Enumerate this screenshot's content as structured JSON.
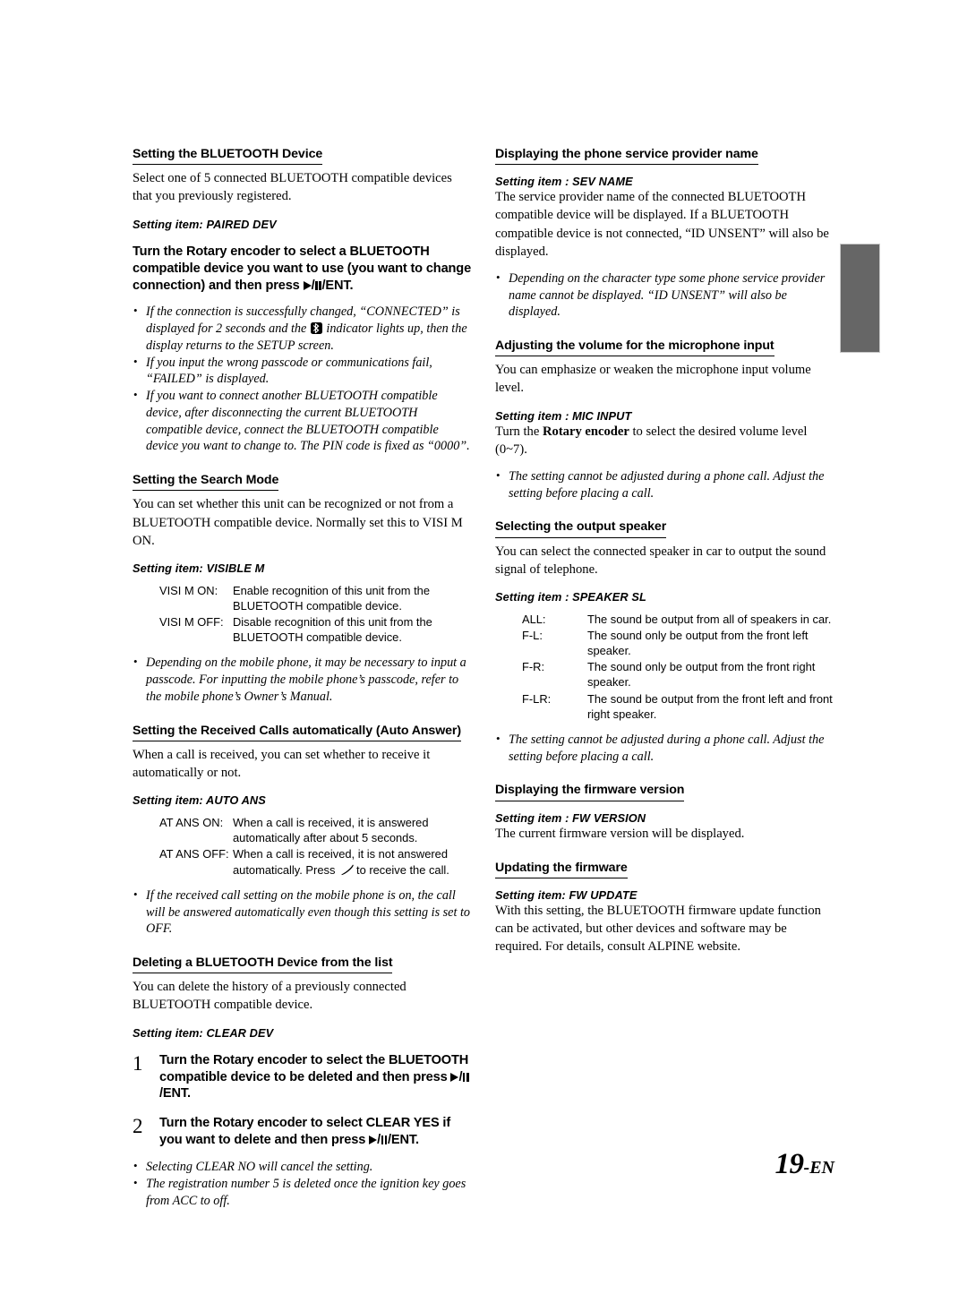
{
  "document": {
    "page_number": "19",
    "page_suffix": "-EN",
    "thumb_tab": {
      "color": "#666666"
    }
  },
  "left_column": {
    "sections": [
      {
        "heading": "Setting the BLUETOOTH Device",
        "body": [
          "Select one of 5 connected BLUETOOTH compatible devices that you previously registered."
        ],
        "setting_item": "Setting item: PAIRED DEV",
        "instruction_prefix": "Turn the ",
        "instruction_bold": "Rotary encoder",
        "instruction_mid": " to select a BLUETOOTH compatible device you want to use (you want to change connection) and then press ",
        "instruction_suffix": "/ENT.",
        "notes": [
          "If the connection is successfully changed, “CONNECTED” is displayed for 2 seconds and the",
          "indicator lights up, then the display returns to the SETUP screen.",
          "If you input the wrong passcode or communications fail, “FAILED” is displayed.",
          "If you want to connect another BLUETOOTH compatible device, after disconnecting the current BLUETOOTH compatible device, connect the BLUETOOTH compatible device you want to change to. The PIN code is fixed as “0000”."
        ]
      },
      {
        "heading": "Setting the Search Mode",
        "body": [
          "You can set whether this unit can be recognized or not from a BLUETOOTH compatible device. Normally set this to VISI M ON."
        ],
        "setting_item": "Setting item: VISIBLE M",
        "definitions": [
          {
            "term": "VISI M ON:",
            "desc": "Enable recognition of this unit from the BLUETOOTH compatible device."
          },
          {
            "term": "VISI M OFF:",
            "desc": "Disable recognition of this unit from the BLUETOOTH compatible device."
          }
        ],
        "notes": [
          "Depending on the mobile phone, it may be necessary to input a passcode. For inputting the mobile phone’s passcode, refer to the mobile phone’s Owner’s Manual."
        ]
      },
      {
        "heading": "Setting the Received Calls automatically (Auto Answer)",
        "body": [
          "When a call is received, you can set whether to receive it automatically or not."
        ],
        "setting_item": "Setting item: AUTO ANS",
        "definitions": [
          {
            "term": "AT ANS ON:",
            "desc": "When a call is received, it is answered automatically after about 5 seconds."
          },
          {
            "term": "AT ANS OFF:",
            "desc_before": "When a call is received, it is not answered automatically. Press",
            "desc_after": "to receive the call."
          }
        ],
        "notes": [
          "If the received call setting on the mobile phone is on, the call will be answered automatically even though this setting is set to OFF."
        ]
      },
      {
        "heading": "Deleting a BLUETOOTH Device from the list",
        "body": [
          "You can delete the history of a previously connected BLUETOOTH compatible device."
        ],
        "setting_item": "Setting item: CLEAR DEV",
        "steps": [
          {
            "number": "1",
            "prefix": "Turn the ",
            "bold": "Rotary encoder",
            "mid": " to select the BLUETOOTH compatible device to be deleted and then press ",
            "suffix": "/ENT."
          },
          {
            "number": "2",
            "prefix": "Turn the ",
            "bold": "Rotary encoder",
            "mid": " to select CLEAR YES if you want to delete and then press ",
            "suffix": "/ENT."
          }
        ],
        "notes": [
          "Selecting CLEAR NO will cancel the setting.",
          "The registration number 5 is deleted once the ignition key goes from ACC to off."
        ]
      }
    ]
  },
  "right_column": {
    "sections": [
      {
        "heading": "Displaying the phone service provider name",
        "setting_item": "Setting item : SEV NAME",
        "body": [
          "The service provider name of the connected BLUETOOTH compatible device will be displayed. If a BLUETOOTH compatible device is not connected, “ID UNSENT” will also be displayed."
        ],
        "notes": [
          "Depending on the character type some phone service provider name cannot be displayed. “ID UNSENT” will also be displayed."
        ]
      },
      {
        "heading": "Adjusting the volume for the microphone input",
        "body": [
          "You can emphasize or weaken the microphone input volume level."
        ],
        "setting_item": "Setting item : MIC INPUT",
        "body_after_prefix": "Turn the ",
        "body_after_bold": "Rotary encoder",
        "body_after_suffix": " to select the desired volume level (0~7).",
        "notes": [
          "The setting cannot be adjusted during a phone call. Adjust the setting before placing a call."
        ]
      },
      {
        "heading": "Selecting the output speaker",
        "body": [
          "You can select the connected speaker in car to output the sound signal of telephone."
        ],
        "setting_item": "Setting item : SPEAKER SL",
        "definitions": [
          {
            "term": "ALL:",
            "desc": "The sound  be output from all of speakers in car."
          },
          {
            "term": "F-L:",
            "desc": "The sound only be output from the front left speaker."
          },
          {
            "term": "F-R:",
            "desc": "The sound only be output from the front right speaker."
          },
          {
            "term": "F-LR:",
            "desc": "The sound  be output from the front left and front right speaker."
          }
        ],
        "notes": [
          "The setting cannot be adjusted during a phone call. Adjust the setting before placing a call."
        ]
      },
      {
        "heading": "Displaying the firmware version",
        "setting_item": "Setting item : FW VERSION",
        "body": [
          "The current firmware version will be displayed."
        ]
      },
      {
        "heading": "Updating the firmware",
        "setting_item": "Setting item: FW UPDATE",
        "body": [
          "With this setting, the BLUETOOTH firmware update function can be activated, but other devices and software may be required. For details, consult ALPINE website."
        ]
      }
    ]
  },
  "icons": {
    "play_pause": "play-pause-ent-icon",
    "bluetooth": "bluetooth-indicator-icon",
    "phone": "phone-receive-icon"
  }
}
